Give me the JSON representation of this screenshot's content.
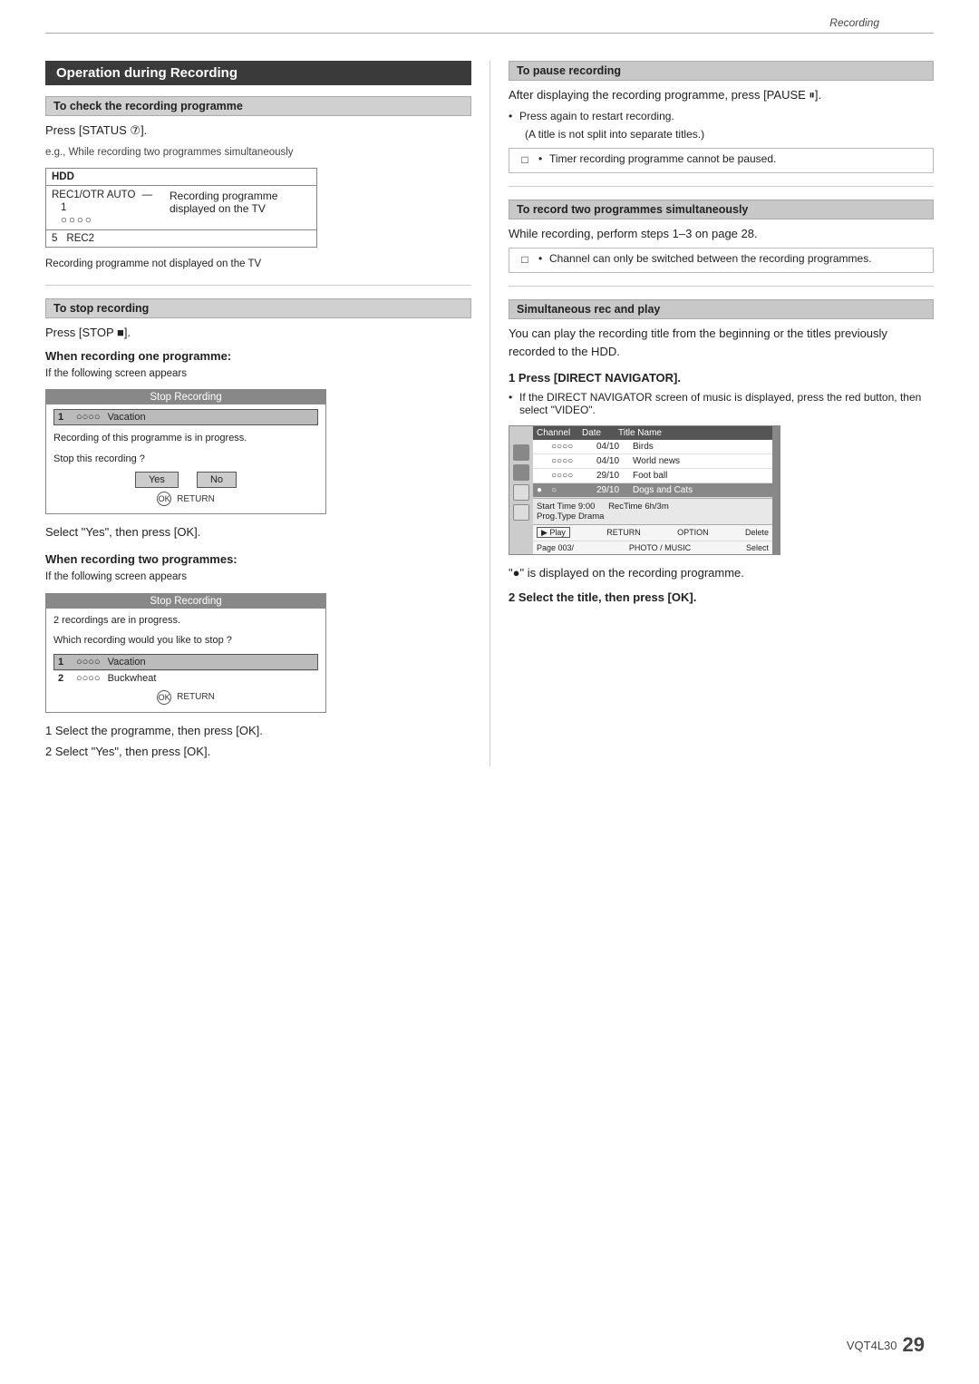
{
  "header": {
    "label": "Recording"
  },
  "main_title": "Operation during Recording",
  "left_column": {
    "check_recording": {
      "header": "To check the recording programme",
      "press_status": "Press [STATUS ⑦].",
      "eg_text": "e.g., While recording two programmes simultaneously",
      "diagram": {
        "hdd": "HDD",
        "rec1": "REC1/OTR AUTO",
        "label_displayed": "Recording programme",
        "label_displayed2": "displayed on the TV",
        "num": "1",
        "circles": "○○○○",
        "rec2_num": "5",
        "rec2": "REC2",
        "not_displayed": "Recording programme not displayed on the TV"
      }
    },
    "stop_recording": {
      "header": "To stop recording",
      "press_stop": "Press [STOP ■].",
      "when_one": {
        "header": "When recording one programme:",
        "sub": "If the following screen appears",
        "screen": {
          "title": "Stop Recording",
          "row1_num": "1",
          "row1_circles": "○○○○",
          "row1_title": "Vacation",
          "body_text1": "Recording of this programme is in progress.",
          "body_text2": "Stop this recording ?",
          "btn_yes": "Yes",
          "btn_no": "No",
          "footer_icon": "OK",
          "footer_text": "RETURN"
        },
        "instruction": "Select \"Yes\", then press [OK]."
      },
      "when_two": {
        "header": "When recording two programmes:",
        "sub": "If the following screen appears",
        "screen": {
          "title": "Stop Recording",
          "body_text1": "2 recordings are in progress.",
          "body_text2": "Which recording would you like to stop ?",
          "row1_num": "1",
          "row1_circles": "○○○○",
          "row1_title": "Vacation",
          "row2_num": "2",
          "row2_circles": "○○○○",
          "row2_title": "Buckwheat",
          "footer_icon": "OK",
          "footer_text": "RETURN"
        },
        "step1": "1  Select the programme, then press [OK].",
        "step2": "2  Select \"Yes\", then press [OK]."
      }
    }
  },
  "right_column": {
    "pause_recording": {
      "header": "To pause recording",
      "text1": "After displaying the recording programme, press [PAUSE ⏸].",
      "bullet1": "Press again to restart recording.",
      "bullet1_sub": "(A title is not split into separate titles.)",
      "note_bullet": "Timer recording programme cannot be paused."
    },
    "record_two": {
      "header": "To record two programmes simultaneously",
      "text": "While recording, perform steps 1–3 on page 28.",
      "note_bullet": "Channel can only be switched between the recording programmes."
    },
    "simultaneous": {
      "header": "Simultaneous rec and play",
      "text1": "You can play the recording title from the beginning or the titles previously recorded to the HDD.",
      "step1": "1  Press [DIRECT NAVIGATOR].",
      "step1_bullet": "If the DIRECT NAVIGATOR screen of music is displayed, press the red button, then select \"VIDEO\".",
      "nav_screen": {
        "col1": "Channel",
        "col2": "Date",
        "col3": "Title Name",
        "rows": [
          {
            "icon": "",
            "channel": "○○○○",
            "date": "04/10",
            "title": "Birds"
          },
          {
            "icon": "",
            "channel": "○○○○",
            "date": "04/10",
            "title": "World news"
          },
          {
            "icon": "",
            "channel": "○○○○",
            "date": "29/10",
            "title": "Foot ball"
          },
          {
            "icon": "●",
            "channel": "○",
            "date": "29/10",
            "title": "Dogs and Cats",
            "selected": true
          }
        ],
        "detail": {
          "start": "Start Time  9:00",
          "rectime": "RecTime  6h/3m",
          "progtype": "Prog.Type  Drama"
        },
        "footer_left": "Play",
        "footer_return": "RETURN",
        "footer_option": "OPTION",
        "footer_delete": "Delete",
        "footer_photo": "PHOTO / MUSIC",
        "footer_select": "Select",
        "footer_page": "Page 003/"
      },
      "rec_displayed": "\"●\" is displayed on the recording programme.",
      "step2": "2  Select the title, then press [OK]."
    }
  },
  "footer": {
    "model": "VQT4L30",
    "page": "29"
  }
}
